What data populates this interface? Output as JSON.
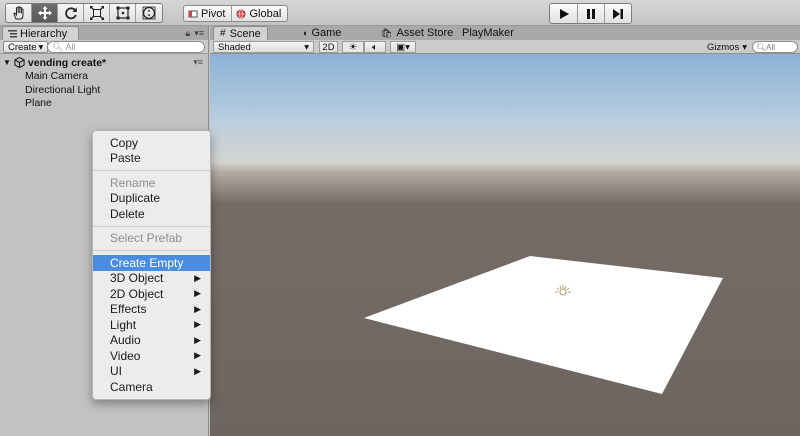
{
  "toolbar": {
    "tools": [
      {
        "name": "hand-tool-icon",
        "active": false
      },
      {
        "name": "move-tool-icon",
        "active": true
      },
      {
        "name": "rotate-tool-icon",
        "active": false
      },
      {
        "name": "scale-tool-icon",
        "active": false
      },
      {
        "name": "rect-tool-icon",
        "active": false
      },
      {
        "name": "transform-tool-icon",
        "active": false
      }
    ],
    "pivot_label": "Pivot",
    "global_label": "Global",
    "play_icons": [
      "play-icon",
      "pause-icon",
      "step-icon"
    ]
  },
  "hierarchy": {
    "tab_label": "Hierarchy",
    "create_label": "Create",
    "search_placeholder": "All",
    "scene_name": "vending create*",
    "items": [
      "Main Camera",
      "Directional Light",
      "Plane"
    ]
  },
  "scene_view": {
    "tabs": [
      {
        "label": "Scene",
        "icon": "grid-icon"
      },
      {
        "label": "Game",
        "icon": "pacman-icon"
      },
      {
        "label": "Asset Store",
        "icon": "bag-icon"
      },
      {
        "label": "PlayMaker",
        "icon": ""
      }
    ],
    "shading_mode": "Shaded",
    "mode_2d_label": "2D",
    "gizmos_label": "Gizmos",
    "search_placeholder": "All"
  },
  "context_menu": {
    "items": [
      {
        "label": "Copy",
        "enabled": true
      },
      {
        "label": "Paste",
        "enabled": true
      },
      {
        "separator": true
      },
      {
        "label": "Rename",
        "enabled": false
      },
      {
        "label": "Duplicate",
        "enabled": true
      },
      {
        "label": "Delete",
        "enabled": true
      },
      {
        "separator": true
      },
      {
        "label": "Select Prefab",
        "enabled": false
      },
      {
        "separator": true
      },
      {
        "label": "Create Empty",
        "enabled": true,
        "highlighted": true
      },
      {
        "label": "3D Object",
        "enabled": true,
        "submenu": true
      },
      {
        "label": "2D Object",
        "enabled": true,
        "submenu": true
      },
      {
        "label": "Effects",
        "enabled": true,
        "submenu": true
      },
      {
        "label": "Light",
        "enabled": true,
        "submenu": true
      },
      {
        "label": "Audio",
        "enabled": true,
        "submenu": true
      },
      {
        "label": "Video",
        "enabled": true,
        "submenu": true
      },
      {
        "label": "UI",
        "enabled": true,
        "submenu": true
      },
      {
        "label": "Camera",
        "enabled": true
      }
    ]
  },
  "colors": {
    "highlight": "#4a8ce0",
    "sky": "#8bb2d7",
    "ground": "#6e6560",
    "plane": "#ffffff"
  }
}
